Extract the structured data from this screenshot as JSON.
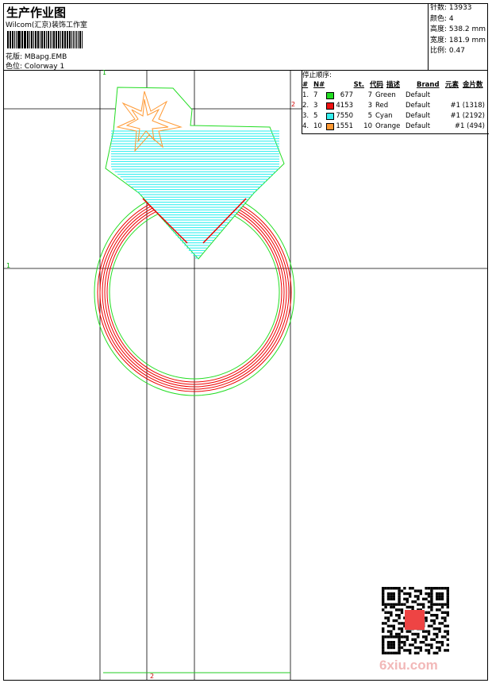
{
  "header": {
    "title": "生产作业图",
    "studio": "Wilcom(汇京)装饰工作室",
    "design_label": "花版:",
    "design_value": "MBapg.EMB",
    "colorway_label": "色位:",
    "colorway_value": "Colorway 1"
  },
  "stats": {
    "stitches": "针数: 13933",
    "colors": "颜色: 4",
    "height": "高度: 538.2 mm",
    "width": "宽度: 181.9 mm",
    "scale": "比例: 0.47"
  },
  "stop_sequence": {
    "caption": "停止顺序:",
    "headers": [
      "#",
      "N#",
      "St.",
      "代码",
      "描述",
      "Brand",
      "元素",
      "金片数"
    ],
    "rows": [
      {
        "idx": "1.",
        "n": "7",
        "color": "#22dd22",
        "st": "677",
        "code": "7",
        "desc": "Green",
        "brand": "Default",
        "elem": "",
        "seq": ""
      },
      {
        "idx": "2.",
        "n": "3",
        "color": "#ee1111",
        "st": "4153",
        "code": "3",
        "desc": "Red",
        "brand": "Default",
        "elem": "",
        "seq": "#1 (1318)"
      },
      {
        "idx": "3.",
        "n": "5",
        "color": "#33eeee",
        "st": "7550",
        "code": "5",
        "desc": "Cyan",
        "brand": "Default",
        "elem": "",
        "seq": "#1 (2192)"
      },
      {
        "idx": "4.",
        "n": "10",
        "color": "#ff9933",
        "st": "1551",
        "code": "10",
        "desc": "Orange",
        "brand": "Default",
        "elem": "",
        "seq": "#1 (494)"
      }
    ]
  },
  "guides": {
    "v1": "1",
    "h2": "2",
    "h1": "1",
    "v2": "2"
  },
  "watermark": "6xiu.com"
}
